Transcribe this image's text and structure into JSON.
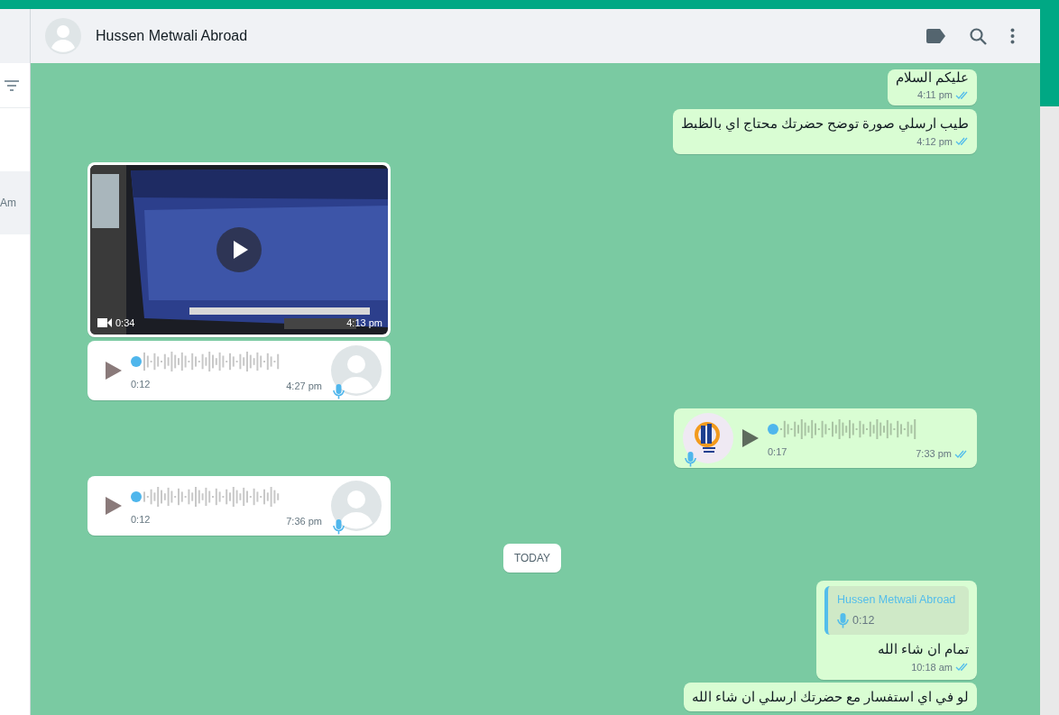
{
  "sidebar": {
    "items": [
      {
        "text": "Am"
      }
    ]
  },
  "chat_header": {
    "contact_name": "Hussen Metwali Abroad"
  },
  "messages": [
    {
      "kind": "text",
      "outgoing": true,
      "text": "عليكم السلام",
      "time": "4:11 pm",
      "read": true
    },
    {
      "kind": "text",
      "outgoing": true,
      "text": "طيب ارسلي صورة توضح حضرتك محتاج اي بالظبط",
      "time": "4:12 pm",
      "read": true
    },
    {
      "kind": "video",
      "outgoing": false,
      "duration": "0:34",
      "time": "4:13 pm"
    },
    {
      "kind": "voice",
      "outgoing": false,
      "duration": "0:12",
      "time": "4:27 pm",
      "level": 0,
      "avatar": {
        "kind": "default"
      }
    },
    {
      "kind": "voice",
      "outgoing": true,
      "duration": "0:17",
      "time": "7:33 pm",
      "level": 0,
      "avatar": {
        "kind": "logo"
      },
      "read": true
    },
    {
      "kind": "voice",
      "outgoing": false,
      "duration": "0:12",
      "time": "7:36 pm",
      "level": 0,
      "avatar": {
        "kind": "default"
      }
    },
    {
      "kind": "date",
      "text": "TODAY"
    },
    {
      "kind": "reply",
      "outgoing": true,
      "quote_author": "Hussen Metwali Abroad",
      "quote_duration": "0:12",
      "text": "تمام ان شاء الله",
      "time": "10:18 am",
      "read": true
    },
    {
      "kind": "text",
      "outgoing": true,
      "text": "لو في اي استفسار مع حضرتك ارسلي ان شاء الله"
    }
  ]
}
